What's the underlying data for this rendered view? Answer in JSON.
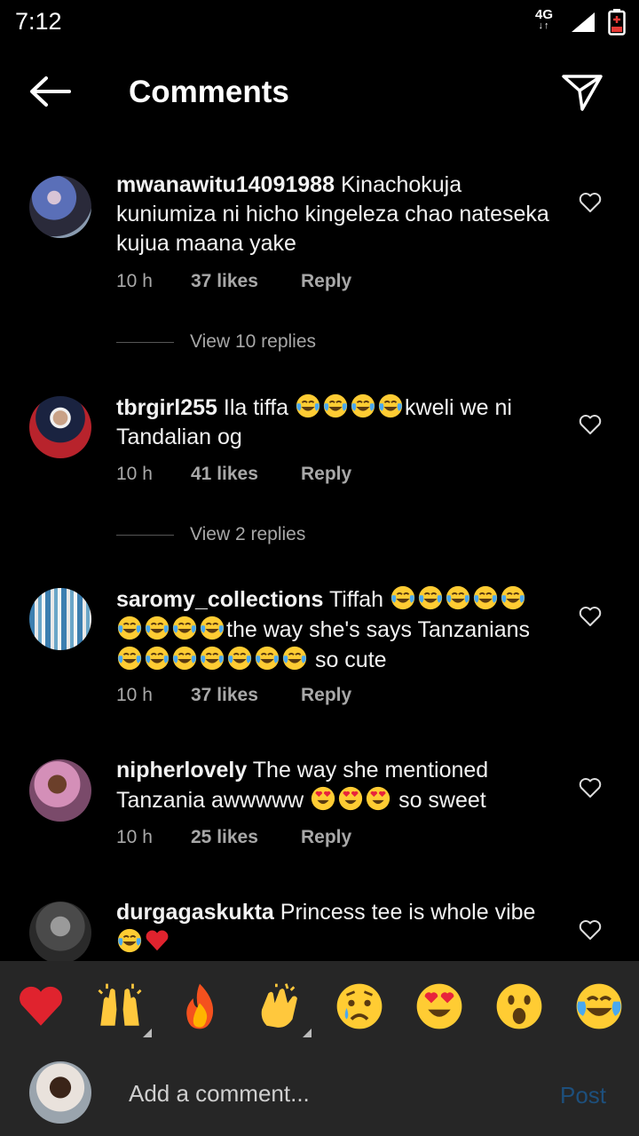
{
  "status_bar": {
    "time": "7:12",
    "network": "4G"
  },
  "header": {
    "title": "Comments"
  },
  "comments": [
    {
      "username": "mwanawitu14091988",
      "text": "Kinachokuja kuniumiza ni hicho kingeleza chao nateseka kujua maana yake",
      "time": "10 h",
      "likes": "37 likes",
      "reply": "Reply",
      "view_replies": "View 10 replies"
    },
    {
      "username": "tbrgirl255",
      "text_parts": [
        "Ila tiffa ",
        "kweli we ni Tandalian og"
      ],
      "time": "10 h",
      "likes": "41 likes",
      "reply": "Reply",
      "view_replies": "View 2 replies"
    },
    {
      "username": "saromy_collections",
      "text_parts": [
        "Tiffah ",
        "the way she's says Tanzanians",
        " so cute"
      ],
      "time": "10 h",
      "likes": "37 likes",
      "reply": "Reply"
    },
    {
      "username": "nipherlovely",
      "text_parts": [
        "The way she mentioned Tanzania awwwww ",
        " so sweet"
      ],
      "time": "10 h",
      "likes": "25 likes",
      "reply": "Reply"
    },
    {
      "username": "durgagaskukta",
      "text_parts": [
        "Princess tee is whole vibe"
      ]
    }
  ],
  "reactions": [
    "red-heart",
    "raising-hands",
    "fire",
    "clapping-hands",
    "crying-face",
    "heart-eyes",
    "surprised-face",
    "tears-of-joy"
  ],
  "comment_input": {
    "placeholder": "Add a comment...",
    "post_label": "Post"
  },
  "colors": {
    "background": "#000000",
    "bar": "#262626",
    "meta_text": "#a8a8a8",
    "post_disabled": "#1d4f7c"
  }
}
